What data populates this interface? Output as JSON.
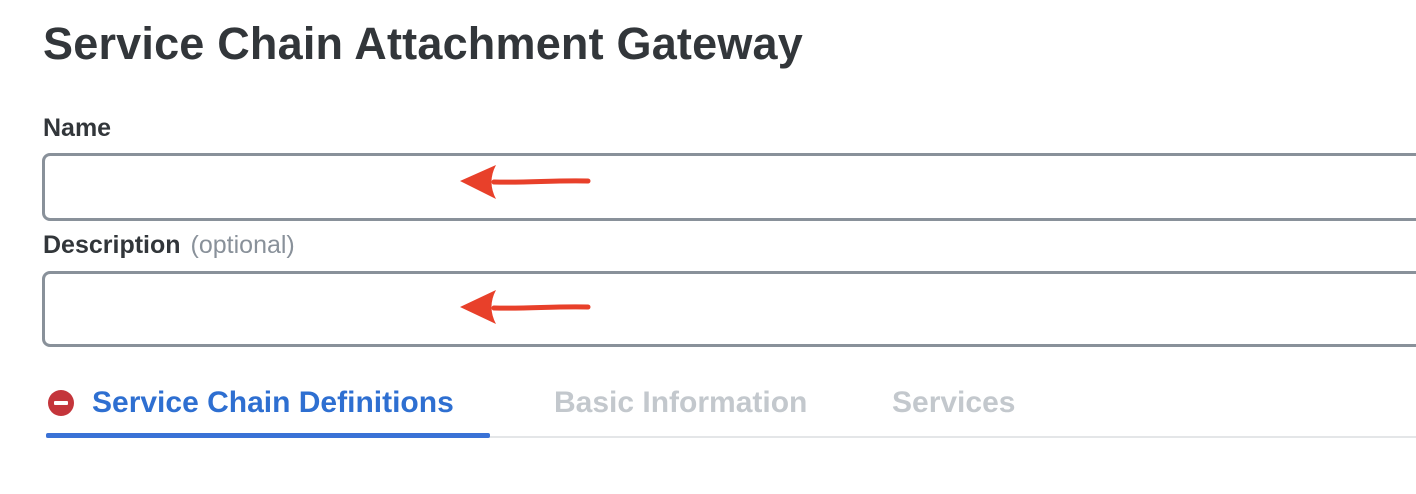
{
  "page": {
    "title": "Service Chain Attachment Gateway"
  },
  "form": {
    "name": {
      "label": "Name",
      "value": ""
    },
    "description": {
      "label": "Description",
      "optional_label": "(optional)",
      "value": ""
    }
  },
  "tabs": [
    {
      "label": "Service Chain Definitions",
      "state": "active",
      "icon": "error-icon"
    },
    {
      "label": "Basic Information",
      "state": "inactive"
    },
    {
      "label": "Services",
      "state": "inactive"
    }
  ],
  "annotations": {
    "arrow_icon": "left-arrow-icon",
    "arrow_color": "#e8402a"
  },
  "colors": {
    "accent": "#3a72d6",
    "error": "#c4353b",
    "inactive_tab": "#c3c8cd"
  }
}
